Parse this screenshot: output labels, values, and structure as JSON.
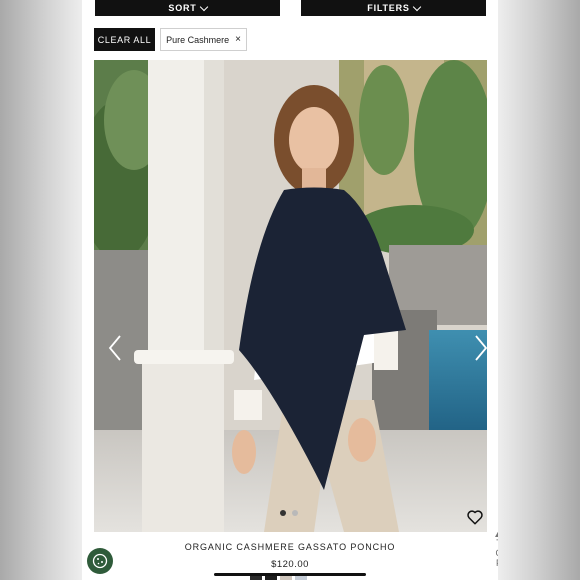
{
  "toolbar": {
    "sort_label": "SORT",
    "filters_label": "FILTERS"
  },
  "filters_applied": {
    "clear_all_label": "CLEAR ALL",
    "chips": [
      {
        "label": "Pure Cashmere",
        "remove_symbol": "×"
      }
    ]
  },
  "product": {
    "name": "ORGANIC CASHMERE GASSATO PONCHO",
    "price": "$120.00",
    "image_count": 2,
    "active_image_index": 1,
    "swatch_colors": [
      "#2c2c2c",
      "#1d1d1d",
      "#cfc6bd",
      "#c5ccd6"
    ]
  },
  "back_to_top": {
    "letters": [
      "T",
      "O",
      "P"
    ]
  },
  "icons": {
    "sort_chevron": "chevron-down-icon",
    "filters_chevron": "chevron-down-icon",
    "carousel_prev": "chevron-left-icon",
    "carousel_next": "chevron-right-icon",
    "wishlist": "heart-icon",
    "cookie_settings": "cookie-icon",
    "back_to_top": "triangle-up-icon"
  },
  "colors": {
    "button_bg": "#111111",
    "cookie_button_bg": "#2f5b3a"
  }
}
